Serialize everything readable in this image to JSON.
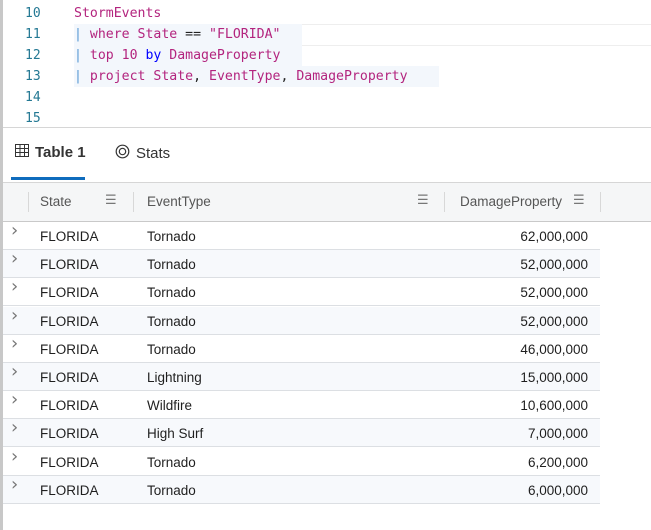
{
  "editor": {
    "lines": [
      {
        "num": "10",
        "tokens": [
          {
            "t": "StormEvents",
            "c": "magenta"
          }
        ]
      },
      {
        "num": "11",
        "tokens": [
          {
            "t": "| ",
            "c": "pipe"
          },
          {
            "t": "where State ",
            "c": "magenta"
          },
          {
            "t": "== ",
            "c": "plain"
          },
          {
            "t": "\"FLORIDA\"",
            "c": "magenta"
          }
        ]
      },
      {
        "num": "12",
        "tokens": [
          {
            "t": "| ",
            "c": "pipe"
          },
          {
            "t": "top 10 ",
            "c": "magenta"
          },
          {
            "t": "by ",
            "c": "blue"
          },
          {
            "t": "DamageProperty",
            "c": "magenta"
          }
        ]
      },
      {
        "num": "13",
        "tokens": [
          {
            "t": "| ",
            "c": "pipe"
          },
          {
            "t": "project State",
            "c": "magenta"
          },
          {
            "t": ", ",
            "c": "plain"
          },
          {
            "t": "EventType",
            "c": "magenta"
          },
          {
            "t": ", ",
            "c": "plain"
          },
          {
            "t": "DamageProperty",
            "c": "magenta"
          }
        ]
      },
      {
        "num": "14",
        "tokens": []
      },
      {
        "num": "15",
        "tokens": []
      }
    ]
  },
  "tabs": [
    {
      "label": "Table 1",
      "icon": "table-icon",
      "active": true
    },
    {
      "label": "Stats",
      "icon": "stats-icon",
      "active": false
    }
  ],
  "table": {
    "columns": [
      "State",
      "EventType",
      "DamageProperty"
    ],
    "rows": [
      [
        "FLORIDA",
        "Tornado",
        "62,000,000"
      ],
      [
        "FLORIDA",
        "Tornado",
        "52,000,000"
      ],
      [
        "FLORIDA",
        "Tornado",
        "52,000,000"
      ],
      [
        "FLORIDA",
        "Tornado",
        "52,000,000"
      ],
      [
        "FLORIDA",
        "Tornado",
        "46,000,000"
      ],
      [
        "FLORIDA",
        "Lightning",
        "15,000,000"
      ],
      [
        "FLORIDA",
        "Wildfire",
        "10,600,000"
      ],
      [
        "FLORIDA",
        "High Surf",
        "7,000,000"
      ],
      [
        "FLORIDA",
        "Tornado",
        "6,200,000"
      ],
      [
        "FLORIDA",
        "Tornado",
        "6,000,000"
      ]
    ]
  },
  "colors": {
    "accent": "#0f6cbd",
    "keyword": "#b3247e",
    "by_keyword": "#0000ff"
  }
}
